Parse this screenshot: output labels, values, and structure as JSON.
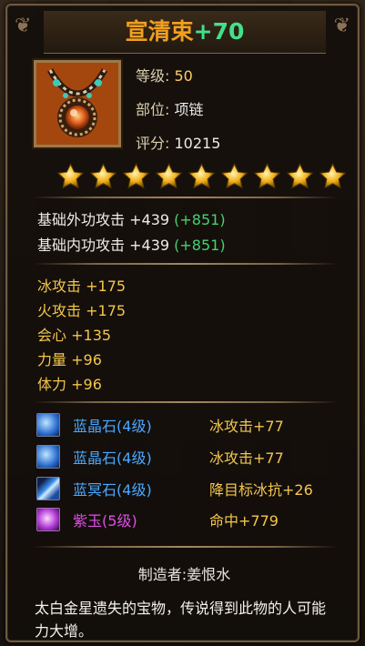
{
  "item": {
    "name": "宣清束",
    "enhance": "+70",
    "level_label": "等级:",
    "level_value": "50",
    "slot_label": "部位:",
    "slot_value": "项链",
    "score_label": "评分:",
    "score_value": "10215",
    "star_count": 9
  },
  "base_attributes": [
    {
      "label": "基础外功攻击",
      "base": "+439",
      "bonus": "(+851)"
    },
    {
      "label": "基础内功攻击",
      "base": "+439",
      "bonus": "(+851)"
    }
  ],
  "extra_attributes": [
    {
      "label": "冰攻击",
      "value": "+175"
    },
    {
      "label": "火攻击",
      "value": "+175"
    },
    {
      "label": "会心",
      "value": "+135"
    },
    {
      "label": "力量",
      "value": "+96"
    },
    {
      "label": "体力",
      "value": "+96"
    }
  ],
  "gems": [
    {
      "name": "蓝晶石",
      "level": "(4级)",
      "effect": "冰攻击+77",
      "color": "#4aa8ff",
      "icon": "blue-crystal-icon"
    },
    {
      "name": "蓝晶石",
      "level": "(4级)",
      "effect": "冰攻击+77",
      "color": "#4aa8ff",
      "icon": "blue-crystal-icon"
    },
    {
      "name": "蓝冥石",
      "level": "(4级)",
      "effect": "降目标冰抗+26",
      "color": "#4aa8ff",
      "icon": "blue-shard-icon"
    },
    {
      "name": "紫玉",
      "level": "(5级)",
      "effect": "命中+779",
      "color": "#e04de6",
      "icon": "purple-jade-icon"
    }
  ],
  "maker": "制造者:姜恨水",
  "description": "太白金星遗失的宝物，传说得到此物的人可能力大增。",
  "colors": {
    "title": "#f0a020",
    "enhance": "#43e08b",
    "bonus_green": "#45d36f",
    "attr_yellow": "#f3c64b",
    "gem_blue": "#4aa8ff",
    "gem_purple": "#e04de6"
  }
}
